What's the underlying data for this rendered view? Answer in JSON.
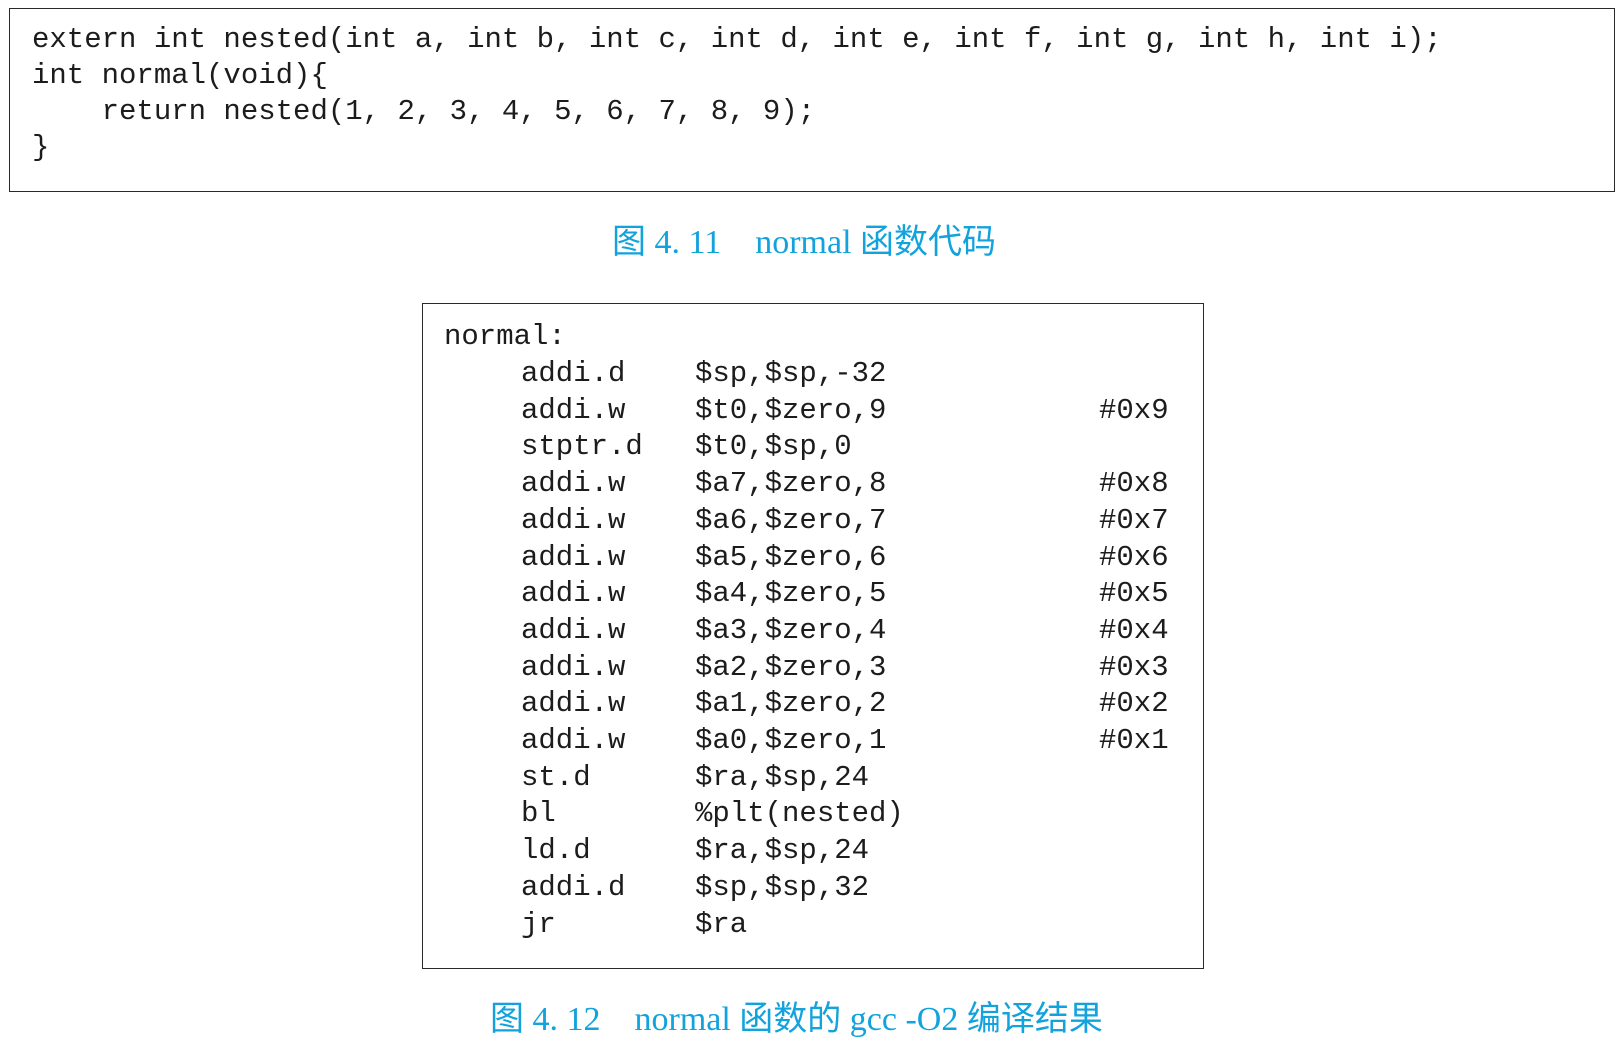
{
  "figure_4_11": {
    "code_lines": [
      "extern int nested(int a, int b, int c, int d, int e, int f, int g, int h, int i);",
      "int normal(void){",
      "    return nested(1, 2, 3, 4, 5, 6, 7, 8, 9);",
      "}"
    ],
    "caption": "图 4. 11    normal 函数代码"
  },
  "figure_4_12": {
    "label": "normal:",
    "rows": [
      {
        "op": "addi.d",
        "args": "$sp,$sp,-32",
        "comment": ""
      },
      {
        "op": "addi.w",
        "args": "$t0,$zero,9",
        "comment": "#0x9"
      },
      {
        "op": "stptr.d",
        "args": "$t0,$sp,0",
        "comment": ""
      },
      {
        "op": "addi.w",
        "args": "$a7,$zero,8",
        "comment": "#0x8"
      },
      {
        "op": "addi.w",
        "args": "$a6,$zero,7",
        "comment": "#0x7"
      },
      {
        "op": "addi.w",
        "args": "$a5,$zero,6",
        "comment": "#0x6"
      },
      {
        "op": "addi.w",
        "args": "$a4,$zero,5",
        "comment": "#0x5"
      },
      {
        "op": "addi.w",
        "args": "$a3,$zero,4",
        "comment": "#0x4"
      },
      {
        "op": "addi.w",
        "args": "$a2,$zero,3",
        "comment": "#0x3"
      },
      {
        "op": "addi.w",
        "args": "$a1,$zero,2",
        "comment": "#0x2"
      },
      {
        "op": "addi.w",
        "args": "$a0,$zero,1",
        "comment": "#0x1"
      },
      {
        "op": "st.d",
        "args": "$ra,$sp,24",
        "comment": ""
      },
      {
        "op": "bl",
        "args": "%plt(nested)",
        "comment": ""
      },
      {
        "op": "ld.d",
        "args": "$ra,$sp,24",
        "comment": ""
      },
      {
        "op": "addi.d",
        "args": "$sp,$sp,32",
        "comment": ""
      },
      {
        "op": "jr",
        "args": "$ra",
        "comment": ""
      }
    ],
    "caption": "图 4. 12    normal 函数的 gcc -O2 编译结果"
  },
  "colors": {
    "caption": "#12a3dc",
    "code_text": "#1c1c1c",
    "border": "#2a2a2a"
  }
}
